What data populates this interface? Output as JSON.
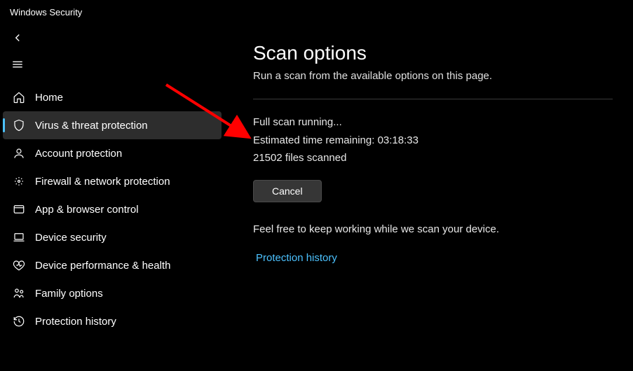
{
  "app": {
    "title": "Windows Security"
  },
  "sidebar": {
    "items": [
      {
        "label": "Home"
      },
      {
        "label": "Virus & threat protection"
      },
      {
        "label": "Account protection"
      },
      {
        "label": "Firewall & network protection"
      },
      {
        "label": "App & browser control"
      },
      {
        "label": "Device security"
      },
      {
        "label": "Device performance & health"
      },
      {
        "label": "Family options"
      },
      {
        "label": "Protection history"
      }
    ]
  },
  "main": {
    "title": "Scan options",
    "subtitle": "Run a scan from the available options on this page.",
    "status_running": "Full scan running...",
    "status_estimate": "Estimated time remaining: 03:18:33",
    "status_files": "21502 files scanned",
    "cancel_label": "Cancel",
    "hint": "Feel free to keep working while we scan your device.",
    "link_label": "Protection history"
  },
  "colors": {
    "accent": "#4cc2ff",
    "arrow": "#ff0000"
  }
}
